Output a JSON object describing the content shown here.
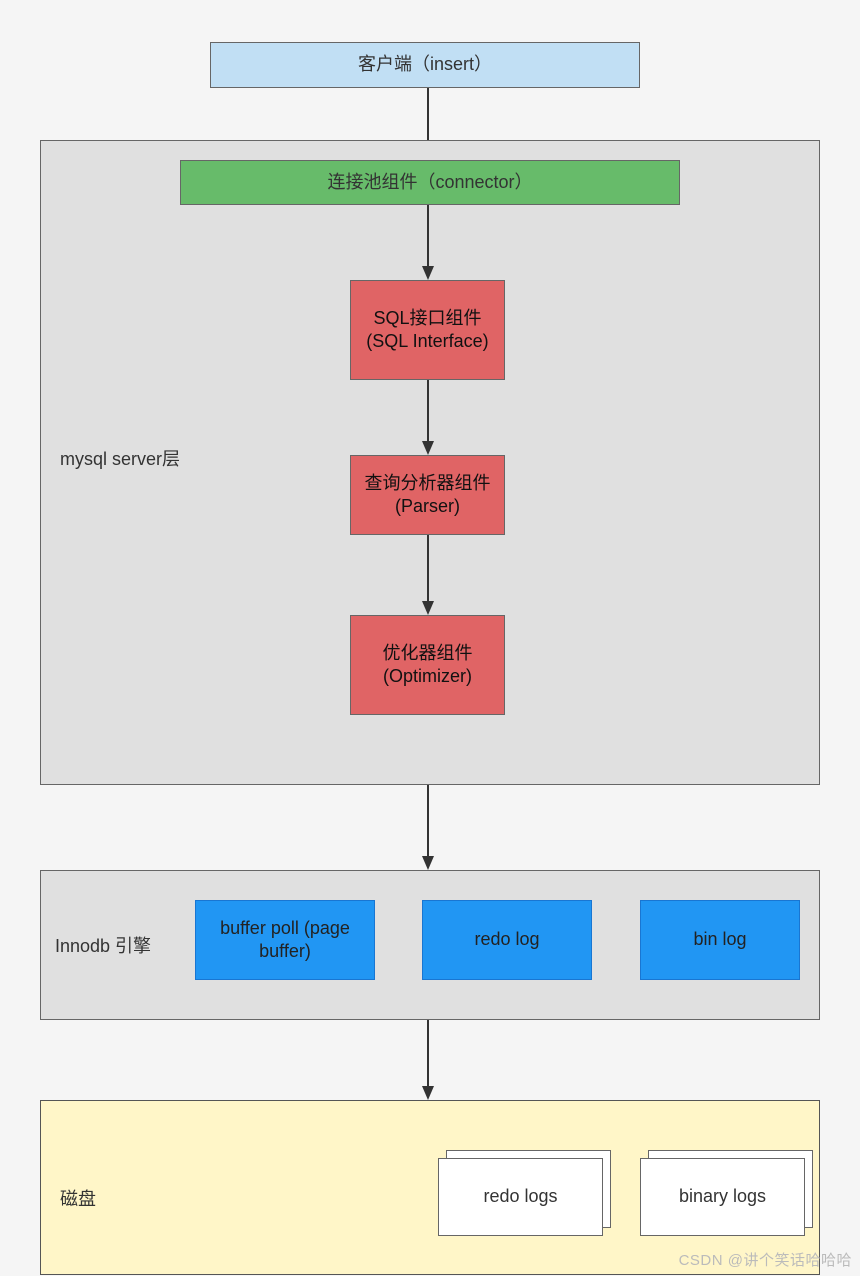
{
  "client": {
    "label": "客户端（insert）"
  },
  "server": {
    "title": "mysql server层",
    "connector": "连接池组件（connector）",
    "sql_interface": "SQL接口组件(SQL Interface)",
    "parser": "查询分析器组件(Parser)",
    "optimizer": "优化器组件(Optimizer)"
  },
  "innodb": {
    "title": "Innodb 引擎",
    "buffer": "buffer poll (page buffer)",
    "redo": "redo log",
    "binlog": "bin log"
  },
  "disk": {
    "title": "磁盘",
    "redo_logs": "redo logs",
    "binary_logs": "binary logs"
  },
  "watermark": "CSDN @讲个笑话哈哈哈"
}
